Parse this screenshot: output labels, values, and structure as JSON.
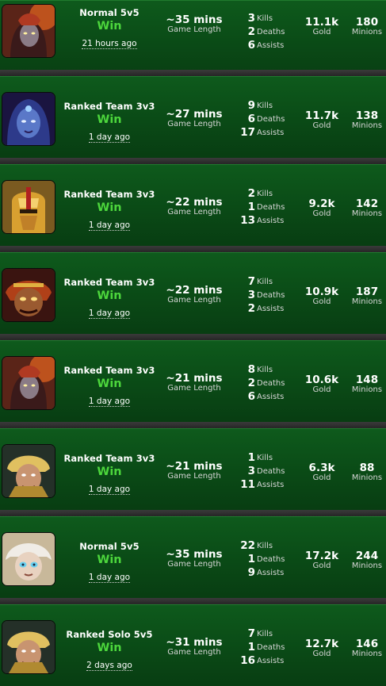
{
  "matches": [
    {
      "champion_icon": "champion-portrait-icon",
      "mode": "Normal 5v5",
      "result": "Win",
      "ago": "21 hours ago",
      "length": "~35 mins",
      "length_label": "Game Length",
      "kills": "3",
      "deaths": "2",
      "assists": "6",
      "kills_label": "Kills",
      "deaths_label": "Deaths",
      "assists_label": "Assists",
      "gold": "11.1k",
      "gold_label": "Gold",
      "minions": "180",
      "minions_label": "Minions"
    },
    {
      "champion_icon": "champion-portrait-icon",
      "mode": "Ranked Team 3v3",
      "result": "Win",
      "ago": "1 day ago",
      "length": "~27 mins",
      "length_label": "Game Length",
      "kills": "9",
      "deaths": "6",
      "assists": "17",
      "kills_label": "Kills",
      "deaths_label": "Deaths",
      "assists_label": "Assists",
      "gold": "11.7k",
      "gold_label": "Gold",
      "minions": "138",
      "minions_label": "Minions"
    },
    {
      "champion_icon": "champion-portrait-icon",
      "mode": "Ranked Team 3v3",
      "result": "Win",
      "ago": "1 day ago",
      "length": "~22 mins",
      "length_label": "Game Length",
      "kills": "2",
      "deaths": "1",
      "assists": "13",
      "kills_label": "Kills",
      "deaths_label": "Deaths",
      "assists_label": "Assists",
      "gold": "9.2k",
      "gold_label": "Gold",
      "minions": "142",
      "minions_label": "Minions"
    },
    {
      "champion_icon": "champion-portrait-icon",
      "mode": "Ranked Team 3v3",
      "result": "Win",
      "ago": "1 day ago",
      "length": "~22 mins",
      "length_label": "Game Length",
      "kills": "7",
      "deaths": "3",
      "assists": "2",
      "kills_label": "Kills",
      "deaths_label": "Deaths",
      "assists_label": "Assists",
      "gold": "10.9k",
      "gold_label": "Gold",
      "minions": "187",
      "minions_label": "Minions"
    },
    {
      "champion_icon": "champion-portrait-icon",
      "mode": "Ranked Team 3v3",
      "result": "Win",
      "ago": "1 day ago",
      "length": "~21 mins",
      "length_label": "Game Length",
      "kills": "8",
      "deaths": "2",
      "assists": "6",
      "kills_label": "Kills",
      "deaths_label": "Deaths",
      "assists_label": "Assists",
      "gold": "10.6k",
      "gold_label": "Gold",
      "minions": "148",
      "minions_label": "Minions"
    },
    {
      "champion_icon": "champion-portrait-icon",
      "mode": "Ranked Team 3v3",
      "result": "Win",
      "ago": "1 day ago",
      "length": "~21 mins",
      "length_label": "Game Length",
      "kills": "1",
      "deaths": "3",
      "assists": "11",
      "kills_label": "Kills",
      "deaths_label": "Deaths",
      "assists_label": "Assists",
      "gold": "6.3k",
      "gold_label": "Gold",
      "minions": "88",
      "minions_label": "Minions"
    },
    {
      "champion_icon": "champion-portrait-icon",
      "mode": "Normal 5v5",
      "result": "Win",
      "ago": "1 day ago",
      "length": "~35 mins",
      "length_label": "Game Length",
      "kills": "22",
      "deaths": "1",
      "assists": "9",
      "kills_label": "Kills",
      "deaths_label": "Deaths",
      "assists_label": "Assists",
      "gold": "17.2k",
      "gold_label": "Gold",
      "minions": "244",
      "minions_label": "Minions"
    },
    {
      "champion_icon": "champion-portrait-icon",
      "mode": "Ranked Solo 5v5",
      "result": "Win",
      "ago": "2 days ago",
      "length": "~31 mins",
      "length_label": "Game Length",
      "kills": "7",
      "deaths": "1",
      "assists": "16",
      "kills_label": "Kills",
      "deaths_label": "Deaths",
      "assists_label": "Assists",
      "gold": "12.7k",
      "gold_label": "Gold",
      "minions": "146",
      "minions_label": "Minions"
    }
  ],
  "colors": {
    "win": "#4cd63c",
    "row_bg_top": "#0e5a1c",
    "row_bg_bottom": "#083d12",
    "separator": "#2e2e2e"
  }
}
